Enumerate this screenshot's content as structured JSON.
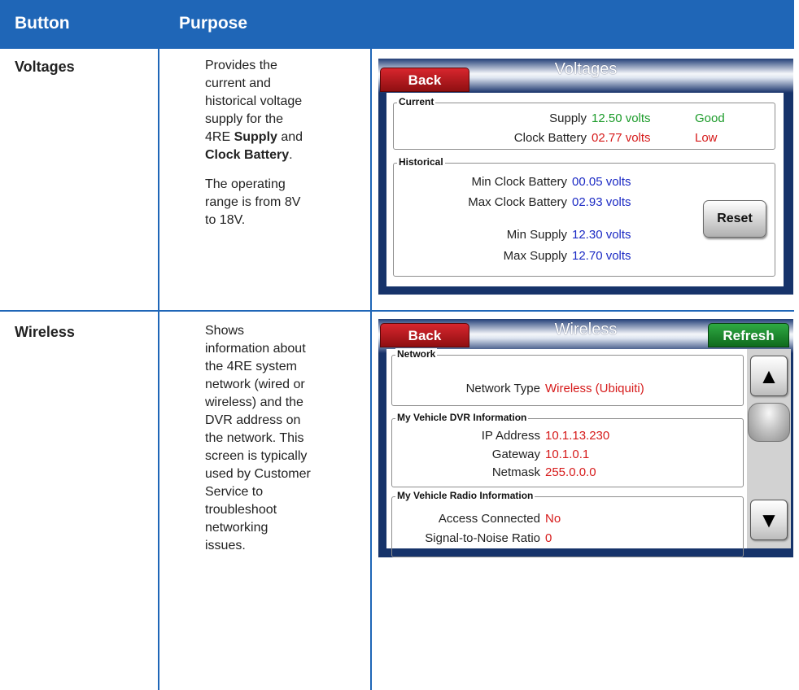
{
  "table": {
    "header": {
      "button": "Button",
      "purpose": "Purpose"
    },
    "rows": [
      {
        "button": "Voltages",
        "purpose_lines": [
          "Provides the",
          "current and",
          "historical",
          "voltage supply",
          "for the 4RE",
          "Supply and",
          "Clock Battery."
        ],
        "purpose_p1_parts": [
          "Provides the current and historical voltage supply for the 4RE ",
          "Supply",
          " and ",
          "Clock Battery",
          "."
        ],
        "purpose_p2": "The operating range is from 8V to 18V."
      },
      {
        "button": "Wireless",
        "purpose": "Shows information about the 4RE system network (wired or wireless) and the DVR address on the network. This screen is typically used by Customer Service to troubleshoot networking issues."
      }
    ]
  },
  "voltages_screen": {
    "title": "Voltages",
    "back_label": "Back",
    "current_group": "Current",
    "supply_label": "Supply",
    "supply_value": "12.50 volts",
    "supply_status": "Good",
    "clock_label": "Clock Battery",
    "clock_value": "02.77 volts",
    "clock_status": "Low",
    "historical_group": "Historical",
    "min_clock_label": "Min Clock Battery",
    "min_clock_value": "00.05 volts",
    "max_clock_label": "Max Clock Battery",
    "max_clock_value": "02.93 volts",
    "min_supply_label": "Min Supply",
    "min_supply_value": "12.30 volts",
    "max_supply_label": "Max Supply",
    "max_supply_value": "12.70 volts",
    "reset_label": "Reset",
    "colors": {
      "good": "#1c9b2a",
      "low": "#d61a1a",
      "historical": "#1b2ac4"
    }
  },
  "wireless_screen": {
    "title": "Wireless",
    "back_label": "Back",
    "refresh_label": "Refresh",
    "network_group": "Network",
    "network_type_label": "Network Type",
    "network_type_value": "Wireless (Ubiquiti)",
    "dvr_group": "My Vehicle DVR Information",
    "ip_label": "IP Address",
    "ip_value": "10.1.13.230",
    "gateway_label": "Gateway",
    "gateway_value": "10.1.0.1",
    "netmask_label": "Netmask",
    "netmask_value": "255.0.0.0",
    "radio_group": "My Vehicle Radio Information",
    "access_label": "Access Connected",
    "access_value": "No",
    "snr_label": "Signal-to-Noise Ratio",
    "snr_value": "0",
    "scroll_up_icon": "triangle-up-icon",
    "scroll_down_icon": "triangle-down-icon"
  }
}
